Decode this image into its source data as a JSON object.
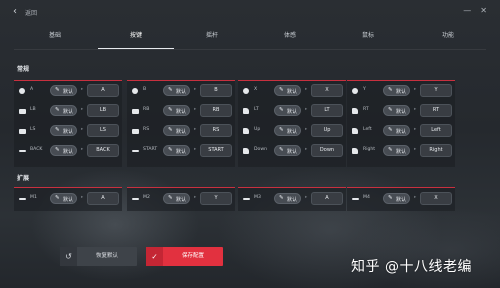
{
  "header": {
    "back_label": "返回"
  },
  "tabs": [
    {
      "label": "基础",
      "active": false
    },
    {
      "label": "按键",
      "active": true
    },
    {
      "label": "摇杆",
      "active": false
    },
    {
      "label": "体感",
      "active": false
    },
    {
      "label": "鼠标",
      "active": false
    },
    {
      "label": "功能",
      "active": false
    }
  ],
  "sections": {
    "general": "常规",
    "extended": "扩展"
  },
  "default_label": "默认",
  "general_columns": [
    [
      {
        "name": "A",
        "key": "A",
        "icon": "button-circle-icon"
      },
      {
        "name": "LB",
        "key": "LB",
        "icon": "bumper-icon"
      },
      {
        "name": "LS",
        "key": "LS",
        "icon": "stick-icon"
      },
      {
        "name": "BACK",
        "key": "BACK",
        "icon": "back-bar-icon"
      }
    ],
    [
      {
        "name": "B",
        "key": "B",
        "icon": "button-circle-icon"
      },
      {
        "name": "RB",
        "key": "RB",
        "icon": "bumper-icon"
      },
      {
        "name": "RS",
        "key": "RS",
        "icon": "stick-icon"
      },
      {
        "name": "START",
        "key": "START",
        "icon": "start-bar-icon"
      }
    ],
    [
      {
        "name": "X",
        "key": "X",
        "icon": "button-circle-icon"
      },
      {
        "name": "LT",
        "key": "LT",
        "icon": "trigger-icon"
      },
      {
        "name": "Up",
        "key": "Up",
        "icon": "dpad-up-icon"
      },
      {
        "name": "Down",
        "key": "Down",
        "icon": "dpad-down-icon"
      }
    ],
    [
      {
        "name": "Y",
        "key": "Y",
        "icon": "button-circle-icon"
      },
      {
        "name": "RT",
        "key": "RT",
        "icon": "trigger-icon"
      },
      {
        "name": "Left",
        "key": "Left",
        "icon": "dpad-left-icon"
      },
      {
        "name": "Right",
        "key": "Right",
        "icon": "dpad-right-icon"
      }
    ]
  ],
  "extended_columns": [
    {
      "name": "M1",
      "key": "A",
      "icon": "macro-bar-icon"
    },
    {
      "name": "M2",
      "key": "Y",
      "icon": "macro-bar-icon"
    },
    {
      "name": "M3",
      "key": "A",
      "icon": "macro-bar-icon"
    },
    {
      "name": "M4",
      "key": "X",
      "icon": "macro-bar-icon"
    }
  ],
  "footer": {
    "restore_label": "恢复默认",
    "save_label": "保存配置"
  },
  "watermark": "知乎 @十八线老编",
  "colors": {
    "accent": "#e2313f",
    "panel_line": "#c8303f"
  }
}
